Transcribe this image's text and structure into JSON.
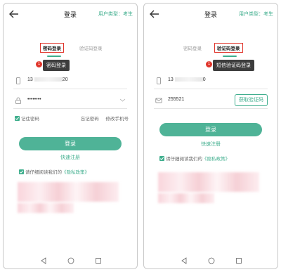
{
  "left": {
    "header": {
      "title": "登录",
      "user_type": "用户类型：考生"
    },
    "tabs": {
      "password": "密码登录",
      "sms": "验证码登录"
    },
    "callout": {
      "badge": "1",
      "text": "密码登录"
    },
    "phone_field": {
      "value": "13",
      "suffix": "20"
    },
    "password_field": {
      "value": "••••••••"
    },
    "options": {
      "remember": "记住密码",
      "forgot": "忘记密码",
      "change_phone": "修改手机号"
    },
    "login_button": "登录",
    "register_link": "快速注册",
    "privacy": {
      "prefix": "请仔细阅读我们的",
      "link": "《隐私政策》"
    }
  },
  "right": {
    "header": {
      "title": "登录",
      "user_type": "用户类型：考生"
    },
    "tabs": {
      "password": "密码登录",
      "sms": "验证码登录"
    },
    "callout": {
      "badge": "1",
      "text": "短信验证码登录"
    },
    "phone_field": {
      "value": "13",
      "suffix": "0"
    },
    "code_field": {
      "value": "255521"
    },
    "get_code_button": "获取验证码",
    "login_button": "登录",
    "register_link": "快速注册",
    "privacy": {
      "prefix": "请仔细阅读我们的",
      "link": "《隐私政策》"
    }
  },
  "colors": {
    "accent": "#3fae8d",
    "highlight": "#e0352b",
    "button": "#4fb397"
  },
  "icons": [
    "back-icon",
    "phone-icon",
    "lock-icon",
    "mail-icon",
    "chevron-down-icon",
    "check-icon",
    "nav-back-icon",
    "nav-home-icon",
    "nav-recent-icon"
  ]
}
